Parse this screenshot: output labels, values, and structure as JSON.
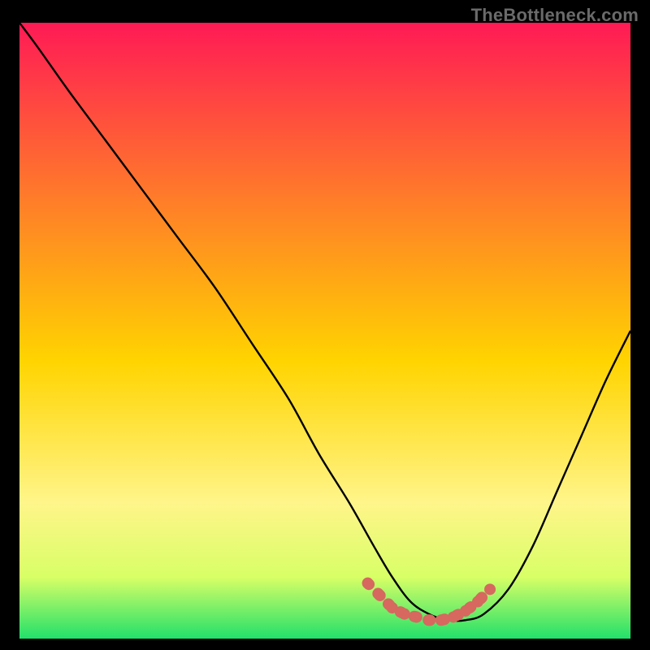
{
  "watermark": "TheBottleneck.com",
  "colors": {
    "background": "#000000",
    "gradient_top": "#ff1a55",
    "gradient_mid_upper": "#ff7a2a",
    "gradient_mid": "#ffd400",
    "gradient_low": "#fff58a",
    "gradient_lower": "#d8ff66",
    "gradient_bottom": "#22e06a",
    "curve": "#000000",
    "marker": "#d6685f"
  },
  "chart_data": {
    "type": "line",
    "title": "",
    "xlabel": "",
    "ylabel": "",
    "xlim": [
      0,
      100
    ],
    "ylim": [
      0,
      100
    ],
    "series": [
      {
        "name": "bottleneck-curve",
        "x": [
          0,
          3,
          8,
          14,
          20,
          26,
          32,
          38,
          44,
          49,
          54,
          58,
          61,
          64,
          67,
          70,
          73,
          76,
          80,
          84,
          88,
          92,
          96,
          100
        ],
        "y": [
          100,
          96,
          89,
          81,
          73,
          65,
          57,
          48,
          39,
          30,
          22,
          15,
          10,
          6,
          4,
          3,
          3,
          4,
          8,
          15,
          24,
          33,
          42,
          50
        ]
      }
    ],
    "markers": {
      "name": "optimal-range-dots",
      "x": [
        57,
        59,
        61,
        63,
        65,
        67,
        69,
        71,
        73,
        75,
        77
      ],
      "y": [
        9,
        7,
        5,
        4,
        3.5,
        3,
        3,
        3.5,
        4.5,
        6,
        8
      ]
    }
  }
}
